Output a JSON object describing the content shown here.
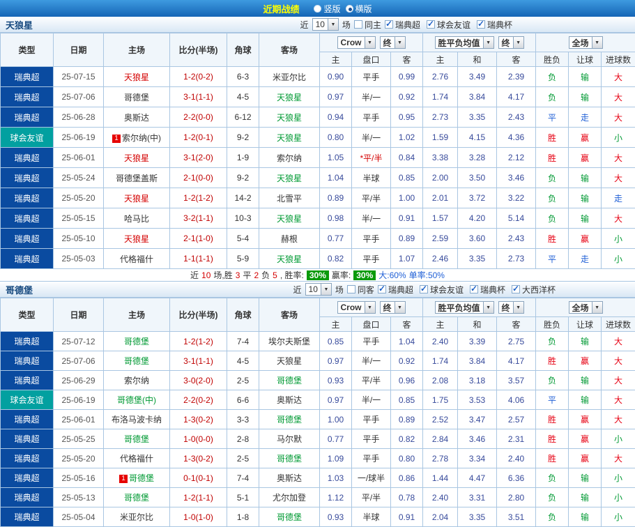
{
  "titlebar": {
    "title": "近期战绩",
    "options": [
      {
        "label": "竖版",
        "selected": false
      },
      {
        "label": "横版",
        "selected": true
      }
    ]
  },
  "filter_labels": {
    "near": "近",
    "games": "场"
  },
  "table_header": {
    "cols": [
      "类型",
      "日期",
      "主场",
      "比分(半场)",
      "角球",
      "客场"
    ],
    "sub": [
      "主",
      "盘口",
      "客",
      "主",
      "和",
      "客",
      "胜负",
      "让球",
      "进球数"
    ],
    "selects": {
      "bookmaker": "Crow",
      "final1": "终",
      "avg": "胜平负均值",
      "final2": "终",
      "scope": "全场"
    }
  },
  "sections": [
    {
      "team": "天狼星",
      "near_count": "10",
      "same_venue": {
        "label": "同主",
        "checked": false
      },
      "leagues": [
        {
          "label": "瑞典超",
          "checked": true
        },
        {
          "label": "球会友谊",
          "checked": true
        },
        {
          "label": "瑞典杯",
          "checked": true
        }
      ],
      "rows": [
        {
          "type": "瑞典超",
          "type_cls": "lg",
          "date": "25-07-15",
          "home": "天狼星",
          "home_cls": "red",
          "home_badge": "",
          "score": "1-2(0-2)",
          "corner": "6-3",
          "away": "米亚尔比",
          "away_cls": "",
          "away_badge": "",
          "o1": "0.90",
          "hc": "平手",
          "hc_cls": "",
          "o2": "0.99",
          "m1": "2.76",
          "m2": "3.49",
          "m3": "2.39",
          "r1": "负",
          "r2": "输",
          "r3": "大"
        },
        {
          "type": "瑞典超",
          "type_cls": "lg",
          "date": "25-07-06",
          "home": "哥德堡",
          "home_cls": "",
          "home_badge": "",
          "score": "3-1(1-1)",
          "corner": "4-5",
          "away": "天狼星",
          "away_cls": "green",
          "away_badge": "",
          "o1": "0.97",
          "hc": "半/一",
          "hc_cls": "",
          "o2": "0.92",
          "m1": "1.74",
          "m2": "3.84",
          "m3": "4.17",
          "r1": "负",
          "r2": "输",
          "r3": "大"
        },
        {
          "type": "瑞典超",
          "type_cls": "lg",
          "date": "25-06-28",
          "home": "奥斯达",
          "home_cls": "",
          "home_badge": "",
          "score": "2-2(0-0)",
          "corner": "6-12",
          "away": "天狼星",
          "away_cls": "green",
          "away_badge": "",
          "o1": "0.94",
          "hc": "平手",
          "hc_cls": "",
          "o2": "0.95",
          "m1": "2.73",
          "m2": "3.35",
          "m3": "2.43",
          "r1": "平",
          "r2": "走",
          "r3": "大"
        },
        {
          "type": "球会友谊",
          "type_cls": "fr",
          "date": "25-06-19",
          "home": "索尔纳(中)",
          "home_cls": "",
          "home_badge": "1",
          "score": "1-2(0-1)",
          "corner": "9-2",
          "away": "天狼星",
          "away_cls": "green",
          "away_badge": "",
          "o1": "0.80",
          "hc": "半/一",
          "hc_cls": "",
          "o2": "1.02",
          "m1": "1.59",
          "m2": "4.15",
          "m3": "4.36",
          "r1": "胜",
          "r2": "赢",
          "r3": "小"
        },
        {
          "type": "瑞典超",
          "type_cls": "lg",
          "date": "25-06-01",
          "home": "天狼星",
          "home_cls": "red",
          "home_badge": "",
          "score": "3-1(2-0)",
          "corner": "1-9",
          "away": "索尔纳",
          "away_cls": "",
          "away_badge": "",
          "o1": "1.05",
          "hc": "*平/半",
          "hc_cls": "red",
          "o2": "0.84",
          "m1": "3.38",
          "m2": "3.28",
          "m3": "2.12",
          "r1": "胜",
          "r2": "赢",
          "r3": "大"
        },
        {
          "type": "瑞典超",
          "type_cls": "lg",
          "date": "25-05-24",
          "home": "哥德堡盖斯",
          "home_cls": "",
          "home_badge": "",
          "score": "2-1(0-0)",
          "corner": "9-2",
          "away": "天狼星",
          "away_cls": "green",
          "away_badge": "",
          "o1": "1.04",
          "hc": "半球",
          "hc_cls": "",
          "o2": "0.85",
          "m1": "2.00",
          "m2": "3.50",
          "m3": "3.46",
          "r1": "负",
          "r2": "输",
          "r3": "大"
        },
        {
          "type": "瑞典超",
          "type_cls": "lg",
          "date": "25-05-20",
          "home": "天狼星",
          "home_cls": "red",
          "home_badge": "",
          "score": "1-2(1-2)",
          "corner": "14-2",
          "away": "北雪平",
          "away_cls": "",
          "away_badge": "",
          "o1": "0.89",
          "hc": "平/半",
          "hc_cls": "",
          "o2": "1.00",
          "m1": "2.01",
          "m2": "3.72",
          "m3": "3.22",
          "r1": "负",
          "r2": "输",
          "r3": "走"
        },
        {
          "type": "瑞典超",
          "type_cls": "lg",
          "date": "25-05-15",
          "home": "哈马比",
          "home_cls": "",
          "home_badge": "",
          "score": "3-2(1-1)",
          "corner": "10-3",
          "away": "天狼星",
          "away_cls": "green",
          "away_badge": "",
          "o1": "0.98",
          "hc": "半/一",
          "hc_cls": "",
          "o2": "0.91",
          "m1": "1.57",
          "m2": "4.20",
          "m3": "5.14",
          "r1": "负",
          "r2": "输",
          "r3": "大"
        },
        {
          "type": "瑞典超",
          "type_cls": "lg",
          "date": "25-05-10",
          "home": "天狼星",
          "home_cls": "red",
          "home_badge": "",
          "score": "2-1(1-0)",
          "corner": "5-4",
          "away": "赫根",
          "away_cls": "",
          "away_badge": "",
          "o1": "0.77",
          "hc": "平手",
          "hc_cls": "",
          "o2": "0.89",
          "m1": "2.59",
          "m2": "3.60",
          "m3": "2.43",
          "r1": "胜",
          "r2": "赢",
          "r3": "小"
        },
        {
          "type": "瑞典超",
          "type_cls": "lg",
          "date": "25-05-03",
          "home": "代格福什",
          "home_cls": "",
          "home_badge": "",
          "score": "1-1(1-1)",
          "corner": "5-9",
          "away": "天狼星",
          "away_cls": "green",
          "away_badge": "",
          "o1": "0.82",
          "hc": "平手",
          "hc_cls": "",
          "o2": "1.07",
          "m1": "2.46",
          "m2": "3.35",
          "m3": "2.73",
          "r1": "平",
          "r2": "走",
          "r3": "小"
        }
      ],
      "summary": {
        "segments": [
          {
            "text": "近",
            "cls": "k"
          },
          {
            "text": "10",
            "cls": "r"
          },
          {
            "text": "场,胜",
            "cls": "k"
          },
          {
            "text": "3",
            "cls": "r"
          },
          {
            "text": "平",
            "cls": "k"
          },
          {
            "text": "2",
            "cls": "r"
          },
          {
            "text": "负",
            "cls": "k"
          },
          {
            "text": "5",
            "cls": "r"
          },
          {
            "text": ", 胜率:",
            "cls": "k"
          },
          {
            "text": "30%",
            "cls": "box"
          },
          {
            "text": "赢率:",
            "cls": "k"
          },
          {
            "text": "30%",
            "cls": "box"
          },
          {
            "text": "大:60%",
            "cls": "b"
          },
          {
            "text": "单率:50%",
            "cls": "b"
          }
        ]
      }
    },
    {
      "team": "哥德堡",
      "near_count": "10",
      "same_venue": {
        "label": "同客",
        "checked": false
      },
      "leagues": [
        {
          "label": "瑞典超",
          "checked": true
        },
        {
          "label": "球会友谊",
          "checked": true
        },
        {
          "label": "瑞典杯",
          "checked": true
        },
        {
          "label": "大西洋杯",
          "checked": true
        }
      ],
      "rows": [
        {
          "type": "瑞典超",
          "type_cls": "lg",
          "date": "25-07-12",
          "home": "哥德堡",
          "home_cls": "green",
          "home_badge": "",
          "score": "1-2(1-2)",
          "corner": "7-4",
          "away": "埃尔夫斯堡",
          "away_cls": "",
          "away_badge": "",
          "o1": "0.85",
          "hc": "平手",
          "hc_cls": "",
          "o2": "1.04",
          "m1": "2.40",
          "m2": "3.39",
          "m3": "2.75",
          "r1": "负",
          "r2": "输",
          "r3": "大"
        },
        {
          "type": "瑞典超",
          "type_cls": "lg",
          "date": "25-07-06",
          "home": "哥德堡",
          "home_cls": "green",
          "home_badge": "",
          "score": "3-1(1-1)",
          "corner": "4-5",
          "away": "天狼星",
          "away_cls": "",
          "away_badge": "",
          "o1": "0.97",
          "hc": "半/一",
          "hc_cls": "",
          "o2": "0.92",
          "m1": "1.74",
          "m2": "3.84",
          "m3": "4.17",
          "r1": "胜",
          "r2": "赢",
          "r3": "大"
        },
        {
          "type": "瑞典超",
          "type_cls": "lg",
          "date": "25-06-29",
          "home": "索尔纳",
          "home_cls": "",
          "home_badge": "",
          "score": "3-0(2-0)",
          "corner": "2-5",
          "away": "哥德堡",
          "away_cls": "green",
          "away_badge": "",
          "o1": "0.93",
          "hc": "平/半",
          "hc_cls": "",
          "o2": "0.96",
          "m1": "2.08",
          "m2": "3.18",
          "m3": "3.57",
          "r1": "负",
          "r2": "输",
          "r3": "大"
        },
        {
          "type": "球会友谊",
          "type_cls": "fr",
          "date": "25-06-19",
          "home": "哥德堡(中)",
          "home_cls": "green",
          "home_badge": "",
          "score": "2-2(0-2)",
          "corner": "6-6",
          "away": "奥斯达",
          "away_cls": "",
          "away_badge": "",
          "o1": "0.97",
          "hc": "半/一",
          "hc_cls": "",
          "o2": "0.85",
          "m1": "1.75",
          "m2": "3.53",
          "m3": "4.06",
          "r1": "平",
          "r2": "输",
          "r3": "大"
        },
        {
          "type": "瑞典超",
          "type_cls": "lg",
          "date": "25-06-01",
          "home": "布洛马波卡纳",
          "home_cls": "",
          "home_badge": "",
          "score": "1-3(0-2)",
          "corner": "3-3",
          "away": "哥德堡",
          "away_cls": "green",
          "away_badge": "",
          "o1": "1.00",
          "hc": "平手",
          "hc_cls": "",
          "o2": "0.89",
          "m1": "2.52",
          "m2": "3.47",
          "m3": "2.57",
          "r1": "胜",
          "r2": "赢",
          "r3": "大"
        },
        {
          "type": "瑞典超",
          "type_cls": "lg",
          "date": "25-05-25",
          "home": "哥德堡",
          "home_cls": "green",
          "home_badge": "",
          "score": "1-0(0-0)",
          "corner": "2-8",
          "away": "马尔默",
          "away_cls": "",
          "away_badge": "",
          "o1": "0.77",
          "hc": "平手",
          "hc_cls": "",
          "o2": "0.82",
          "m1": "2.84",
          "m2": "3.46",
          "m3": "2.31",
          "r1": "胜",
          "r2": "赢",
          "r3": "小"
        },
        {
          "type": "瑞典超",
          "type_cls": "lg",
          "date": "25-05-20",
          "home": "代格福什",
          "home_cls": "",
          "home_badge": "",
          "score": "1-3(0-2)",
          "corner": "2-5",
          "away": "哥德堡",
          "away_cls": "green",
          "away_badge": "",
          "o1": "1.09",
          "hc": "平手",
          "hc_cls": "",
          "o2": "0.80",
          "m1": "2.78",
          "m2": "3.34",
          "m3": "2.40",
          "r1": "胜",
          "r2": "赢",
          "r3": "大"
        },
        {
          "type": "瑞典超",
          "type_cls": "lg",
          "date": "25-05-16",
          "home": "哥德堡",
          "home_cls": "green",
          "home_badge": "1",
          "score": "0-1(0-1)",
          "corner": "7-4",
          "away": "奥斯达",
          "away_cls": "",
          "away_badge": "",
          "o1": "1.03",
          "hc": "一/球半",
          "hc_cls": "",
          "o2": "0.86",
          "m1": "1.44",
          "m2": "4.47",
          "m3": "6.36",
          "r1": "负",
          "r2": "输",
          "r3": "小"
        },
        {
          "type": "瑞典超",
          "type_cls": "lg",
          "date": "25-05-13",
          "home": "哥德堡",
          "home_cls": "green",
          "home_badge": "",
          "score": "1-2(1-1)",
          "corner": "5-1",
          "away": "尤尔加登",
          "away_cls": "",
          "away_badge": "",
          "o1": "1.12",
          "hc": "平/半",
          "hc_cls": "",
          "o2": "0.78",
          "m1": "2.40",
          "m2": "3.31",
          "m3": "2.80",
          "r1": "负",
          "r2": "输",
          "r3": "小"
        },
        {
          "type": "瑞典超",
          "type_cls": "lg",
          "date": "25-05-04",
          "home": "米亚尔比",
          "home_cls": "",
          "home_badge": "",
          "score": "1-0(1-0)",
          "corner": "1-8",
          "away": "哥德堡",
          "away_cls": "green",
          "away_badge": "",
          "o1": "0.93",
          "hc": "半球",
          "hc_cls": "",
          "o2": "0.91",
          "m1": "2.04",
          "m2": "3.35",
          "m3": "3.51",
          "r1": "负",
          "r2": "输",
          "r3": "小"
        }
      ],
      "summary": null
    }
  ]
}
